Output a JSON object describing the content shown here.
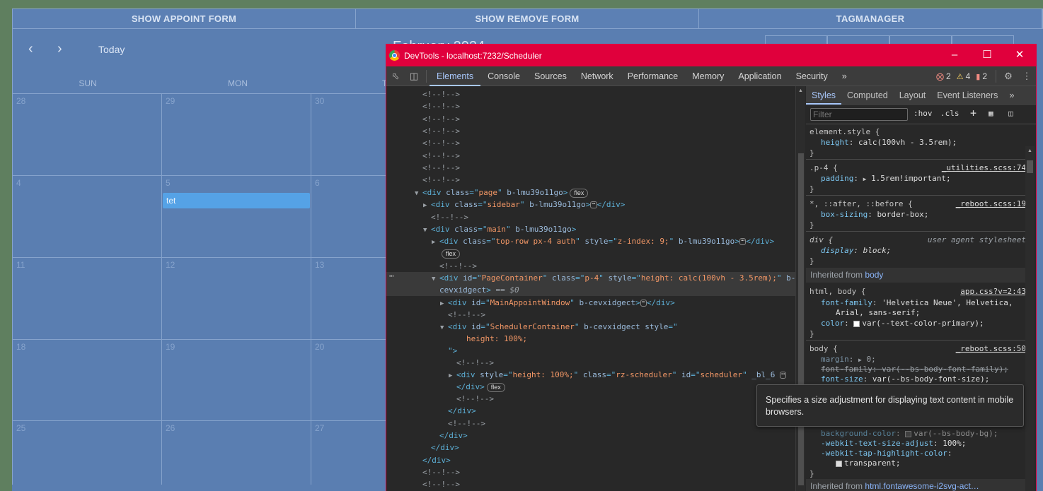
{
  "app": {
    "topbar": [
      "SHOW APPOINT FORM",
      "SHOW REMOVE FORM",
      "TAGMANAGER"
    ],
    "nav": {
      "today": "Today",
      "title": "February 2024"
    },
    "weekdays": [
      "SUN",
      "MON",
      "TU"
    ],
    "weeks": [
      [
        "28",
        "29",
        "30"
      ],
      [
        "4",
        "5",
        "6"
      ],
      [
        "11",
        "12",
        "13"
      ],
      [
        "18",
        "19",
        "20"
      ],
      [
        "25",
        "26",
        "27"
      ]
    ],
    "event": "tet"
  },
  "devtools": {
    "title": "DevTools - localhost:7232/Scheduler",
    "tabs": [
      "Elements",
      "Console",
      "Sources",
      "Network",
      "Performance",
      "Memory",
      "Application",
      "Security"
    ],
    "more": "»",
    "errors": "2",
    "warnings": "4",
    "issues": "2",
    "dom": {
      "comment": "<!--!-->",
      "page_tag": "<div class=\"page\" b-lmu39o11go>",
      "page_div": "div",
      "page_class": "page",
      "page_b": "b-lmu39o11go",
      "flex": "flex",
      "sidebar_class": "sidebar",
      "main_class": "main",
      "toprow_class": "top-row px-4 auth",
      "toprow_style": "z-index: 9;",
      "pc_id": "PageContainer",
      "pc_class": "p-4",
      "pc_style": "height: calc(100vh - 3.5rem);",
      "pc_b": "b-",
      "pc_b2": "cevxidgect",
      "eq": "== $0",
      "maw_id": "MainAppointWindow",
      "b2": "b-cevxidgect",
      "sc_id": "SchedulerContainer",
      "sc_style_open": "style=\"",
      "sc_style_val": "height: 100%;",
      "sc_style_close": "\">",
      "rz_style": "height: 100%;",
      "rz_class": "rz-scheduler",
      "rz_id": "scheduler",
      "rz_b": "_bl_6",
      "close_div": "</div>"
    },
    "styles": {
      "tabs": [
        "Styles",
        "Computed",
        "Layout",
        "Event Listeners"
      ],
      "more": "»",
      "filter_placeholder": "Filter",
      "hov": ":hov",
      "cls": ".cls",
      "rules": {
        "element_style": "element.style {",
        "element_prop": "height",
        "element_val": "calc(100vh - 3.5rem);",
        "p4_sel": ".p-4 {",
        "p4_src": "_utilities.scss:74",
        "p4_prop": "padding",
        "p4_val": "1.5rem!important;",
        "all_sel": "*, ::after, ::before {",
        "all_src": "_reboot.scss:19",
        "all_prop": "box-sizing",
        "all_val": "border-box;",
        "div_sel": "div {",
        "div_src": "user agent stylesheet",
        "div_prop": "display",
        "div_val": "block;",
        "inherited_label": "Inherited from",
        "inherited_body": "body",
        "html_sel": "html, body {",
        "html_src": "app.css?v=2:43",
        "ff_prop": "font-family",
        "ff_val1": "'Helvetica Neue', Helvetica,",
        "ff_val2": "Arial, sans-serif;",
        "color_prop": "color",
        "color_val": "var(--text-color-primary);",
        "body_sel": "body {",
        "body_src": "_reboot.scss:50",
        "margin_prop": "margin",
        "margin_val": "0;",
        "bff_prop": "font-family",
        "bff_val": "var(--bs-body-font-family);",
        "fs_prop": "font-size",
        "fs_val": "var(--bs-body-font-size);",
        "bg_prop": "background-color",
        "bg_val": "var(--bs-body-bg);",
        "wtsa_prop": "-webkit-text-size-adjust",
        "wtsa_val": "100%;",
        "wthc_prop": "-webkit-tap-highlight-color",
        "wthc_val": "transparent;",
        "inherited_html": "html.fontawesome-i2svg-act…",
        "close": "}"
      },
      "tooltip": "Specifies a size adjustment for displaying text content in mobile browsers."
    }
  }
}
